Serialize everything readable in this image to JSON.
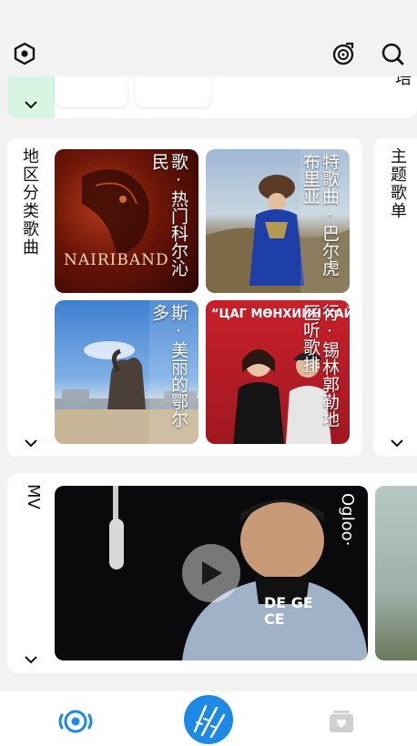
{
  "header": {
    "left_icon": "hexagon-settings-icon",
    "right_icons": [
      "music-disc-icon",
      "search-icon"
    ]
  },
  "top_section": {
    "title_tail": "培"
  },
  "region_section": {
    "title": "地区分类歌曲",
    "tiles": [
      {
        "label": "歌·热门科尔沁民",
        "image_text": "NAIRIBAND"
      },
      {
        "label": "特歌曲·巴尔虎布里亚"
      },
      {
        "label": "斯·美丽的鄂尔多"
      },
      {
        "label": "行·锡林郭勒地区听歌排",
        "image_text": "“ЦАГ МӨНХИЙН ХАЙР”"
      }
    ]
  },
  "theme_section": {
    "title": "主题歌单"
  },
  "mv_section": {
    "title": "MV",
    "video_label": "Ogloo·",
    "video_overlay_text": "DE GECE"
  },
  "bottom_nav": {
    "items": [
      "radio-icon",
      "center-logo-icon",
      "album-icon"
    ]
  },
  "colors": {
    "accent_blue": "#1e88e5",
    "mint": "#d8f5e4",
    "background": "#f2f2f2"
  }
}
